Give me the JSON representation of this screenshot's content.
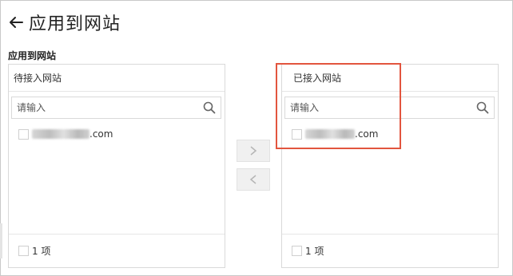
{
  "header": {
    "back_icon": "arrow-left-icon",
    "title": "应用到网站"
  },
  "section_label": "应用到网站",
  "left_panel": {
    "title": "待接入网站",
    "search_placeholder": "请输入",
    "items": [
      {
        "suffix": ".com",
        "checked": false
      }
    ],
    "footer_count": "1 项"
  },
  "right_panel": {
    "title": "已接入网站",
    "search_placeholder": "请输入",
    "items": [
      {
        "suffix": ".com",
        "checked": false
      }
    ],
    "footer_count": "1 项"
  },
  "transfer": {
    "to_right_icon": "chevron-right-icon",
    "to_left_icon": "chevron-left-icon"
  },
  "colors": {
    "highlight": "#e2553e",
    "button_bg": "#f0f0f0",
    "border": "#d9d9d9"
  }
}
